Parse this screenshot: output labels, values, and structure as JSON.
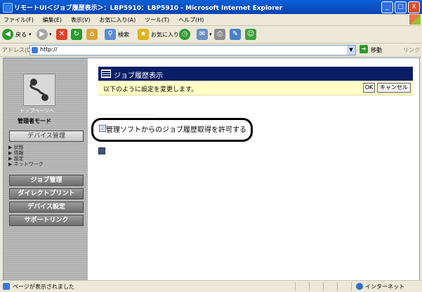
{
  "window": {
    "title": "リモートUI＜ジョブ履歴表示＞：LBP5910：LBP5910 - Microsoft Internet Explorer",
    "buttons": {
      "minimize": "_",
      "maximize": "□",
      "close": "X"
    }
  },
  "menubar": [
    "ファイル(F)",
    "編集(E)",
    "表示(V)",
    "お気に入り(A)",
    "ツール(T)",
    "ヘルプ(H)"
  ],
  "toolbar": {
    "back": "戻る",
    "search": "検索",
    "favorites": "お気に入り"
  },
  "addressbar": {
    "label": "アドレス(D)",
    "url": "http://",
    "go": "移動",
    "links": "リンク"
  },
  "sidebar": {
    "top_link": "トップページへ",
    "mode": "管理者モード",
    "device_mgmt": "デバイス管理",
    "sub_items": [
      "▶ 状態",
      "▶ 情報",
      "▶ 設定",
      "▶ ネットワーク"
    ],
    "buttons": [
      "ジョブ管理",
      "ダイレクトプリント",
      "デバイス設定",
      "サポートリンク"
    ]
  },
  "main": {
    "header_title": "ジョブ履歴表示",
    "notice": "以下のように設定を変更します。",
    "ok_label": "OK",
    "cancel_label": "キャンセル",
    "setting_text": "管理ソフトからのジョブ履歴取得を許可する",
    "checkbox_mark": "☑"
  },
  "statusbar": {
    "text": "ページが表示されました",
    "zone": "インターネット"
  }
}
